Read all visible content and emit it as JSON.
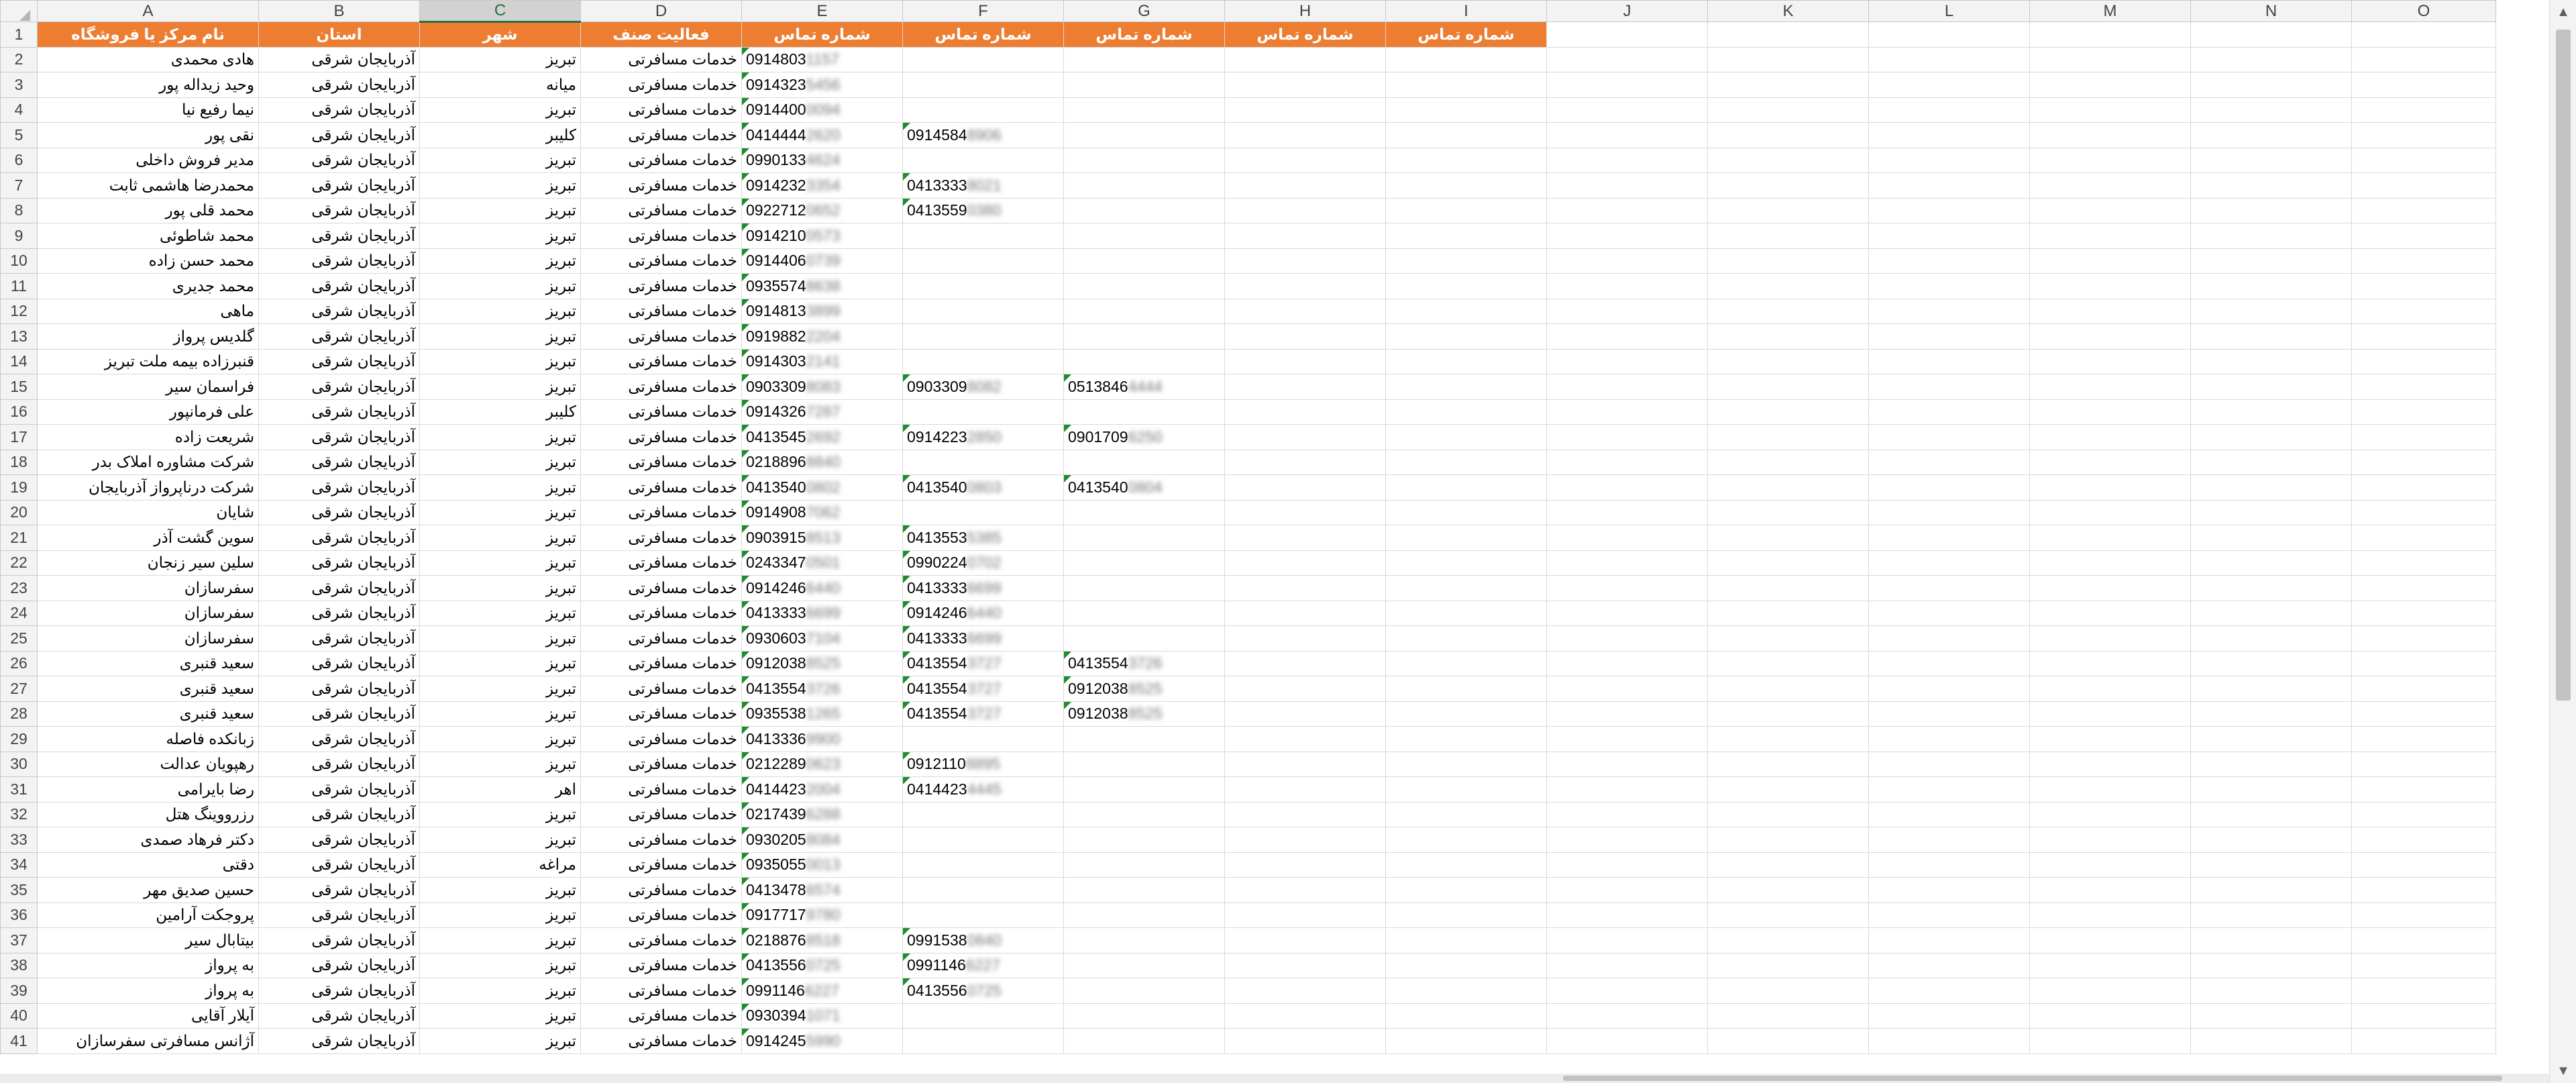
{
  "columns": [
    "A",
    "B",
    "C",
    "D",
    "E",
    "F",
    "G",
    "H",
    "I",
    "J",
    "K",
    "L",
    "M",
    "N",
    "O"
  ],
  "selected_column": "C",
  "headers": [
    "نام مرکز یا فروشگاه",
    "استان",
    "شهر",
    "فعالیت صنف",
    "شماره تماس",
    "شماره تماس",
    "شماره تماس",
    "شماره تماس",
    "شماره تماس"
  ],
  "rows": [
    {
      "n": "2",
      "name": "هادی محمدی",
      "prov": "آذربایجان شرقی",
      "city": "تبریز",
      "act": "خدمات مسافرتی",
      "p1": "0914803",
      "p1b": "1157",
      "p2": "",
      "p2b": "",
      "p3": "",
      "p3b": ""
    },
    {
      "n": "3",
      "name": "وحید زیداله پور",
      "prov": "آذربایجان شرقی",
      "city": "میانه",
      "act": "خدمات مسافرتی",
      "p1": "0914323",
      "p1b": "5456",
      "p2": "",
      "p2b": "",
      "p3": "",
      "p3b": ""
    },
    {
      "n": "4",
      "name": "نیما رفیع نیا",
      "prov": "آذربایجان شرقی",
      "city": "تبریز",
      "act": "خدمات مسافرتی",
      "p1": "0914400",
      "p1b": "0094",
      "p2": "",
      "p2b": "",
      "p3": "",
      "p3b": ""
    },
    {
      "n": "5",
      "name": "نقی پور",
      "prov": "آذربایجان شرقی",
      "city": "کلیبر",
      "act": "خدمات مسافرتی",
      "p1": "0414444",
      "p1b": "2620",
      "p2": "0914584",
      "p2b": "8906",
      "p3": "",
      "p3b": ""
    },
    {
      "n": "6",
      "name": "مدیر فروش داخلی",
      "prov": "آذربایجان شرقی",
      "city": "تبریز",
      "act": "خدمات مسافرتی",
      "p1": "0990133",
      "p1b": "4624",
      "p2": "",
      "p2b": "",
      "p3": "",
      "p3b": ""
    },
    {
      "n": "7",
      "name": "محمدرضا هاشمی ثابت",
      "prov": "آذربایجان شرقی",
      "city": "تبریز",
      "act": "خدمات مسافرتی",
      "p1": "0914232",
      "p1b": "3354",
      "p2": "0413333",
      "p2b": "8021",
      "p3": "",
      "p3b": ""
    },
    {
      "n": "8",
      "name": "محمد قلی پور",
      "prov": "آذربایجان شرقی",
      "city": "تبریز",
      "act": "خدمات مسافرتی",
      "p1": "0922712",
      "p1b": "0652",
      "p2": "0413559",
      "p2b": "0380",
      "p3": "",
      "p3b": ""
    },
    {
      "n": "9",
      "name": "محمد شاطوئی",
      "prov": "آذربایجان شرقی",
      "city": "تبریز",
      "act": "خدمات مسافرتی",
      "p1": "0914210",
      "p1b": "0573",
      "p2": "",
      "p2b": "",
      "p3": "",
      "p3b": ""
    },
    {
      "n": "10",
      "name": "محمد حسن زاده",
      "prov": "آذربایجان شرقی",
      "city": "تبریز",
      "act": "خدمات مسافرتی",
      "p1": "0914406",
      "p1b": "0739",
      "p2": "",
      "p2b": "",
      "p3": "",
      "p3b": ""
    },
    {
      "n": "11",
      "name": "محمد جدیری",
      "prov": "آذربایجان شرقی",
      "city": "تبریز",
      "act": "خدمات مسافرتی",
      "p1": "0935574",
      "p1b": "8638",
      "p2": "",
      "p2b": "",
      "p3": "",
      "p3b": ""
    },
    {
      "n": "12",
      "name": "ماهی",
      "prov": "آذربایجان شرقی",
      "city": "تبریز",
      "act": "خدمات مسافرتی",
      "p1": "0914813",
      "p1b": "3899",
      "p2": "",
      "p2b": "",
      "p3": "",
      "p3b": ""
    },
    {
      "n": "13",
      "name": "گلدیس پرواز",
      "prov": "آذربایجان شرقی",
      "city": "تبریز",
      "act": "خدمات مسافرتی",
      "p1": "0919882",
      "p1b": "2204",
      "p2": "",
      "p2b": "",
      "p3": "",
      "p3b": ""
    },
    {
      "n": "14",
      "name": "قنبرزاده بیمه ملت تبریز",
      "prov": "آذربایجان شرقی",
      "city": "تبریز",
      "act": "خدمات مسافرتی",
      "p1": "0914303",
      "p1b": "2141",
      "p2": "",
      "p2b": "",
      "p3": "",
      "p3b": ""
    },
    {
      "n": "15",
      "name": "فراسمان سیر",
      "prov": "آذربایجان شرقی",
      "city": "تبریز",
      "act": "خدمات مسافرتی",
      "p1": "0903309",
      "p1b": "8083",
      "p2": "0903309",
      "p2b": "8082",
      "p3": "0513846",
      "p3b": "4444"
    },
    {
      "n": "16",
      "name": "علی فرمانپور",
      "prov": "آذربایجان شرقی",
      "city": "کلیبر",
      "act": "خدمات مسافرتی",
      "p1": "0914326",
      "p1b": "7287",
      "p2": "",
      "p2b": "",
      "p3": "",
      "p3b": ""
    },
    {
      "n": "17",
      "name": "شریعت زاده",
      "prov": "آذربایجان شرقی",
      "city": "تبریز",
      "act": "خدمات مسافرتی",
      "p1": "0413545",
      "p1b": "2692",
      "p2": "0914223",
      "p2b": "2850",
      "p3": "0901709",
      "p3b": "6250"
    },
    {
      "n": "18",
      "name": "شرکت مشاوره املاک بدر",
      "prov": "آذربایجان شرقی",
      "city": "تبریز",
      "act": "خدمات مسافرتی",
      "p1": "0218896",
      "p1b": "8840",
      "p2": "",
      "p2b": "",
      "p3": "",
      "p3b": ""
    },
    {
      "n": "19",
      "name": "شرکت درناپرواز آذربایجان",
      "prov": "آذربایجان شرقی",
      "city": "تبریز",
      "act": "خدمات مسافرتی",
      "p1": "0413540",
      "p1b": "0802",
      "p2": "0413540",
      "p2b": "0803",
      "p3": "0413540",
      "p3b": "0804"
    },
    {
      "n": "20",
      "name": "شایان",
      "prov": "آذربایجان شرقی",
      "city": "تبریز",
      "act": "خدمات مسافرتی",
      "p1": "0914908",
      "p1b": "7062",
      "p2": "",
      "p2b": "",
      "p3": "",
      "p3b": ""
    },
    {
      "n": "21",
      "name": "سوین گشت آذر",
      "prov": "آذربایجان شرقی",
      "city": "تبریز",
      "act": "خدمات مسافرتی",
      "p1": "0903915",
      "p1b": "8513",
      "p2": "0413553",
      "p2b": "5385",
      "p3": "",
      "p3b": ""
    },
    {
      "n": "22",
      "name": "سلین سیر زنجان",
      "prov": "آذربایجان شرقی",
      "city": "تبریز",
      "act": "خدمات مسافرتی",
      "p1": "0243347",
      "p1b": "0501",
      "p2": "0990224",
      "p2b": "0702",
      "p3": "",
      "p3b": ""
    },
    {
      "n": "23",
      "name": "سفرسازان",
      "prov": "آذربایجان شرقی",
      "city": "تبریز",
      "act": "خدمات مسافرتی",
      "p1": "0914246",
      "p1b": "6440",
      "p2": "0413333",
      "p2b": "6699",
      "p3": "",
      "p3b": ""
    },
    {
      "n": "24",
      "name": "سفرسازان",
      "prov": "آذربایجان شرقی",
      "city": "تبریز",
      "act": "خدمات مسافرتی",
      "p1": "0413333",
      "p1b": "6699",
      "p2": "0914246",
      "p2b": "6440",
      "p3": "",
      "p3b": ""
    },
    {
      "n": "25",
      "name": "سفرسازان",
      "prov": "آذربایجان شرقی",
      "city": "تبریز",
      "act": "خدمات مسافرتی",
      "p1": "0930603",
      "p1b": "7104",
      "p2": "0413333",
      "p2b": "6699",
      "p3": "",
      "p3b": ""
    },
    {
      "n": "26",
      "name": "سعید قنبری",
      "prov": "آذربایجان شرقی",
      "city": "تبریز",
      "act": "خدمات مسافرتی",
      "p1": "0912038",
      "p1b": "8525",
      "p2": "0413554",
      "p2b": "3727",
      "p3": "0413554",
      "p3b": "3726"
    },
    {
      "n": "27",
      "name": "سعید قنبری",
      "prov": "آذربایجان شرقی",
      "city": "تبریز",
      "act": "خدمات مسافرتی",
      "p1": "0413554",
      "p1b": "3726",
      "p2": "0413554",
      "p2b": "3727",
      "p3": "0912038",
      "p3b": "8525"
    },
    {
      "n": "28",
      "name": "سعید قنبری",
      "prov": "آذربایجان شرقی",
      "city": "تبریز",
      "act": "خدمات مسافرتی",
      "p1": "0935538",
      "p1b": "1265",
      "p2": "0413554",
      "p2b": "3727",
      "p3": "0912038",
      "p3b": "8525"
    },
    {
      "n": "29",
      "name": "زبانکده فاصله",
      "prov": "آذربایجان شرقی",
      "city": "تبریز",
      "act": "خدمات مسافرتی",
      "p1": "0413336",
      "p1b": "9900",
      "p2": "",
      "p2b": "",
      "p3": "",
      "p3b": ""
    },
    {
      "n": "30",
      "name": "رهپویان عدالت",
      "prov": "آذربایجان شرقی",
      "city": "تبریز",
      "act": "خدمات مسافرتی",
      "p1": "0212289",
      "p1b": "0623",
      "p2": "0912110",
      "p2b": "8895",
      "p3": "",
      "p3b": ""
    },
    {
      "n": "31",
      "name": "رضا بایرامی",
      "prov": "آذربایجان شرقی",
      "city": "اهر",
      "act": "خدمات مسافرتی",
      "p1": "0414423",
      "p1b": "2004",
      "p2": "0414423",
      "p2b": "4445",
      "p3": "",
      "p3b": ""
    },
    {
      "n": "32",
      "name": "رزرووینگ هتل",
      "prov": "آذربایجان شرقی",
      "city": "تبریز",
      "act": "خدمات مسافرتی",
      "p1": "0217439",
      "p1b": "6288",
      "p2": "",
      "p2b": "",
      "p3": "",
      "p3b": ""
    },
    {
      "n": "33",
      "name": "دکتر فرهاد صمدی",
      "prov": "آذربایجان شرقی",
      "city": "تبریز",
      "act": "خدمات مسافرتی",
      "p1": "0930205",
      "p1b": "8084",
      "p2": "",
      "p2b": "",
      "p3": "",
      "p3b": ""
    },
    {
      "n": "34",
      "name": "دقتی",
      "prov": "آذربایجان شرقی",
      "city": "مراغه",
      "act": "خدمات مسافرتی",
      "p1": "0935055",
      "p1b": "0013",
      "p2": "",
      "p2b": "",
      "p3": "",
      "p3b": ""
    },
    {
      "n": "35",
      "name": "حسین صدیق مهر",
      "prov": "آذربایجان شرقی",
      "city": "تبریز",
      "act": "خدمات مسافرتی",
      "p1": "0413478",
      "p1b": "6574",
      "p2": "",
      "p2b": "",
      "p3": "",
      "p3b": ""
    },
    {
      "n": "36",
      "name": "پروجکت آرامین",
      "prov": "آذربایجان شرقی",
      "city": "تبریز",
      "act": "خدمات مسافرتی",
      "p1": "0917717",
      "p1b": "9780",
      "p2": "",
      "p2b": "",
      "p3": "",
      "p3b": ""
    },
    {
      "n": "37",
      "name": "بیتابال سیر",
      "prov": "آذربایجان شرقی",
      "city": "تبریز",
      "act": "خدمات مسافرتی",
      "p1": "0218876",
      "p1b": "8518",
      "p2": "0991538",
      "p2b": "0840",
      "p3": "",
      "p3b": ""
    },
    {
      "n": "38",
      "name": "به پرواز",
      "prov": "آذربایجان شرقی",
      "city": "تبریز",
      "act": "خدمات مسافرتی",
      "p1": "0413556",
      "p1b": "0725",
      "p2": "0991146",
      "p2b": "6227",
      "p3": "",
      "p3b": ""
    },
    {
      "n": "39",
      "name": "به پرواز",
      "prov": "آذربایجان شرقی",
      "city": "تبریز",
      "act": "خدمات مسافرتی",
      "p1": "0991146",
      "p1b": "6227",
      "p2": "0413556",
      "p2b": "0725",
      "p3": "",
      "p3b": ""
    },
    {
      "n": "40",
      "name": "آیلار آقایی",
      "prov": "آذربایجان شرقی",
      "city": "تبریز",
      "act": "خدمات مسافرتی",
      "p1": "0930394",
      "p1b": "1071",
      "p2": "",
      "p2b": "",
      "p3": "",
      "p3b": ""
    },
    {
      "n": "41",
      "name": "آژانس مسافرتی سفرسازان",
      "prov": "آذربایجان شرقی",
      "city": "تبریز",
      "act": "خدمات مسافرتی",
      "p1": "0914245",
      "p1b": "5990",
      "p2": "",
      "p2b": "",
      "p3": "",
      "p3b": ""
    }
  ],
  "colors": {
    "header_fill": "#ed7d31",
    "header_text": "#ffffff",
    "comment_marker": "#1e8b2e",
    "gridline": "#d9d9d9"
  }
}
